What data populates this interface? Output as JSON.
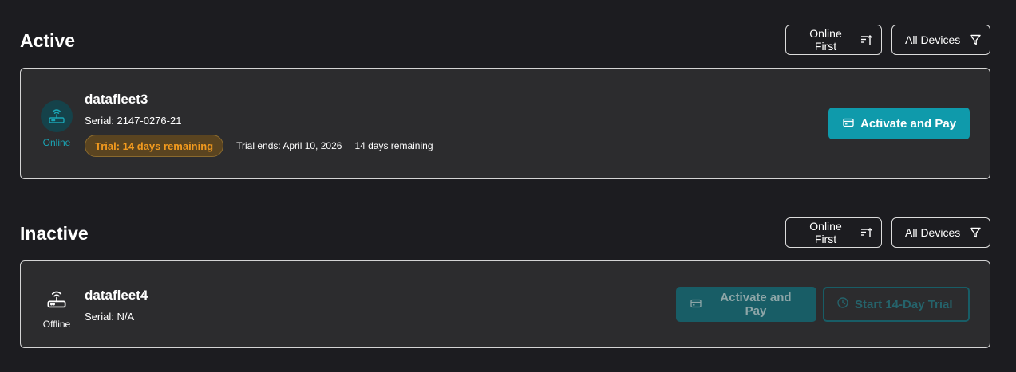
{
  "active": {
    "title": "Active",
    "sort_label": "Online First",
    "filter_label": "All Devices",
    "device": {
      "name": "datafleet3",
      "serial": "Serial: 2147-0276-21",
      "status": "Online",
      "trial_badge": "Trial: 14 days remaining",
      "trial_ends": "Trial ends: April 10, 2026",
      "days_remaining": "14 days remaining",
      "pay_button": "Activate and Pay"
    }
  },
  "inactive": {
    "title": "Inactive",
    "sort_label": "Online First",
    "filter_label": "All Devices",
    "device": {
      "name": "datafleet4",
      "serial": "Serial: N/A",
      "status": "Offline",
      "pay_button": "Activate and Pay",
      "trial_button": "Start 14-Day Trial"
    }
  },
  "icons": {
    "sort": "sort-ascending-icon",
    "filter": "filter-icon",
    "router": "router-icon",
    "card": "credit-card-icon",
    "clock": "clock-icon"
  },
  "colors": {
    "accent": "#0f9aab",
    "online": "#1aa5b5",
    "trial_text": "#f29a1e",
    "background": "#1c1c20",
    "card": "#2c2c2e"
  }
}
